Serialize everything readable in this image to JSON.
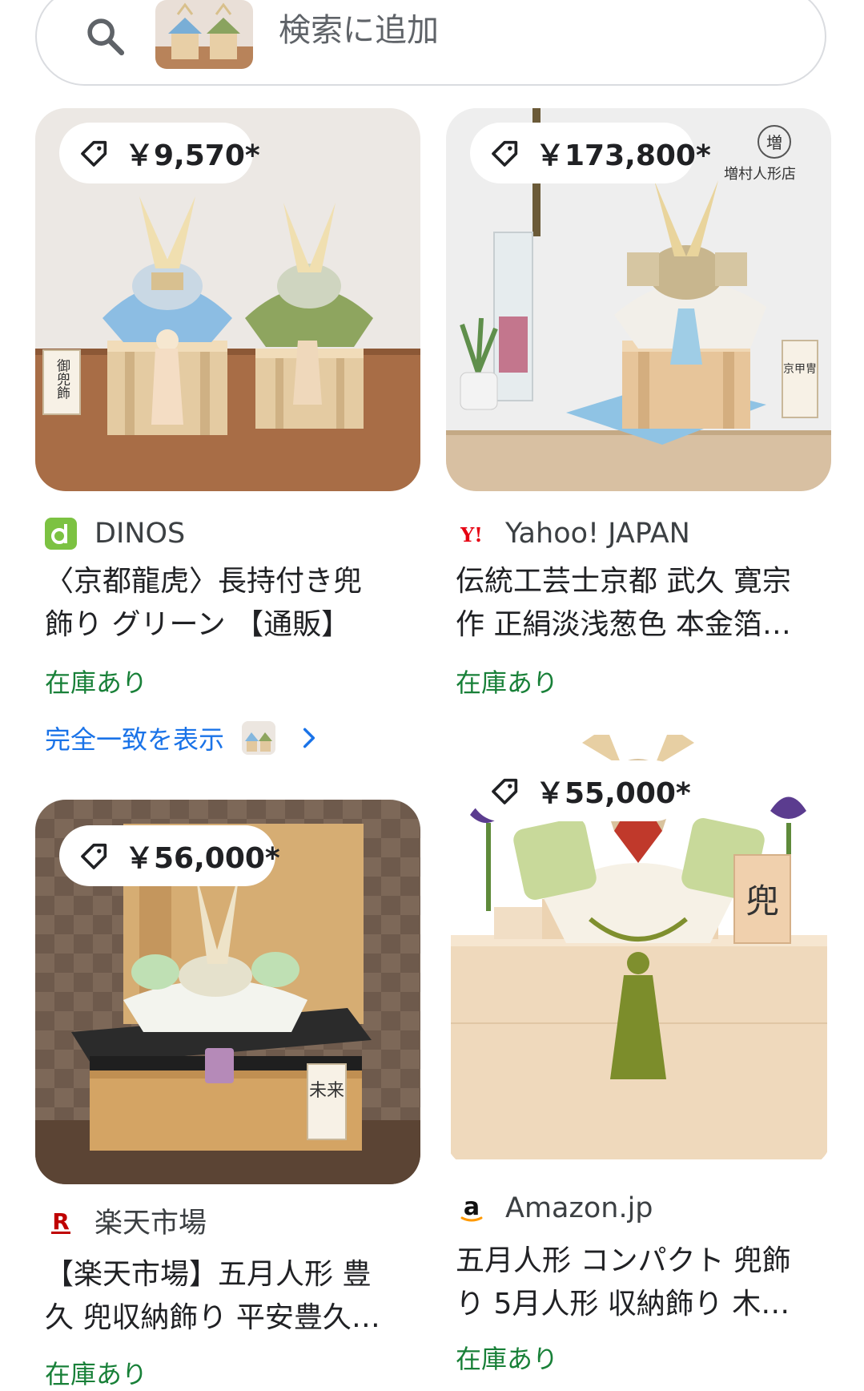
{
  "search": {
    "placeholder": "検索に追加"
  },
  "cards": [
    {
      "price": "￥9,570*",
      "merchant": "DINOS",
      "title_lines": [
        "〈京都龍虎〉長持付き兜",
        "飾り グリーン 【通販】"
      ],
      "stock": "在庫あり"
    },
    {
      "price": "￥173,800*",
      "merchant": "Yahoo! JAPAN",
      "title_lines": [
        "伝統工芸士京都 武久 寛宗",
        "作 正絹淡浅葱色 本金箔…"
      ],
      "stock": "在庫あり"
    },
    {
      "price": "￥56,000*",
      "merchant": "楽天市場",
      "title_lines": [
        "【楽天市場】五月人形 豊",
        "久 兜収納飾り 平安豊久…"
      ],
      "stock": "在庫あり"
    },
    {
      "price": "￥55,000*",
      "merchant": "Amazon.jp",
      "title_lines": [
        "五月人形 コンパクト 兜飾",
        "り 5月人形 収納飾り 木…"
      ],
      "stock": "在庫あり"
    }
  ],
  "exact_match": {
    "label": "完全一致を表示"
  },
  "image_texts": {
    "card1_sign": "御兜飾",
    "card2_logo": "増村人形店",
    "card2_badge": "増",
    "card2_sign": "京甲冑",
    "card3_sign": "未来",
    "card4_sign": "兜"
  },
  "colors": {
    "stock_green": "#188038",
    "link_blue": "#1a73e8",
    "dinos_green": "#7cc242",
    "yahoo_red": "#e60012",
    "rakuten_red": "#bf0000"
  },
  "icons": [
    "search-icon",
    "tag-icon",
    "chevron-right-icon",
    "dinos-logo-icon",
    "yahoo-logo-icon",
    "rakuten-logo-icon",
    "amazon-logo-icon"
  ]
}
